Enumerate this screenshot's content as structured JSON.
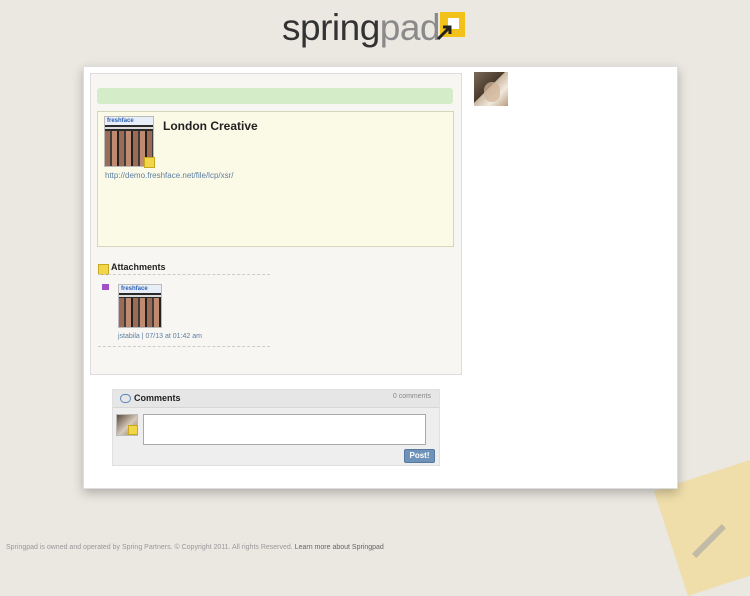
{
  "header": {
    "logo_part1": "spring",
    "logo_part2": "pad"
  },
  "note": {
    "title": "London Creative",
    "link": "http://demo.freshface.net/file/lcp/xsr/",
    "thumb_label": "freshface"
  },
  "attachments": {
    "title": "Attachments",
    "thumb_label": "freshface",
    "meta": "jstabila | 07/13 at 01:42 am"
  },
  "comments": {
    "title": "Comments",
    "count": "0 comments",
    "input_value": "",
    "post_label": "Post!"
  },
  "footer": {
    "text": "Springpad is owned and operated by Spring Partners. © Copyright 2011. All rights Reserved.",
    "link": "Learn more about Springpad"
  },
  "colors": {
    "background": "#ebe7e1",
    "accent_yellow": "#f2d64a",
    "green_bar": "#d4ecc7",
    "link_blue": "#5d7fa3",
    "button_blue": "#6f93b8"
  },
  "icons": {
    "logo_mark": "yellow-square-arrow-icon",
    "note_badge": "sticky-note-icon",
    "attachments": "sticky-note-icon",
    "attachment_type": "purple-file-icon",
    "comments": "speech-bubble-icon"
  }
}
